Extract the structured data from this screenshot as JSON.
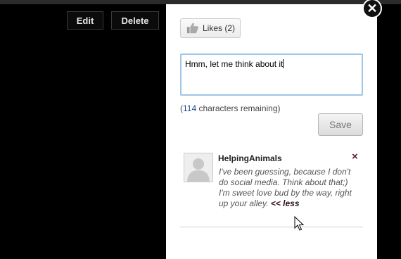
{
  "background_actions": {
    "edit_label": "Edit",
    "delete_label": "Delete"
  },
  "popup": {
    "close_icon": "close-icon",
    "likes_label": "Likes (2)",
    "comment_value": "Hmm, let me think about it",
    "remaining_prefix": "(",
    "remaining_count": "114",
    "remaining_suffix": " characters remaining)",
    "save_label": "Save"
  },
  "comment": {
    "username": "HelpingAnimals",
    "remove_icon": "×",
    "text": "I've been guessing, because I don't do social media. Think about that;) I'm sweet love bud by the way, right up your alley. ",
    "less_label": "<< less"
  },
  "colors": {
    "panel_bg": "#ffffff",
    "input_border": "#9ec6ea",
    "count_color": "#1a4e8a"
  }
}
